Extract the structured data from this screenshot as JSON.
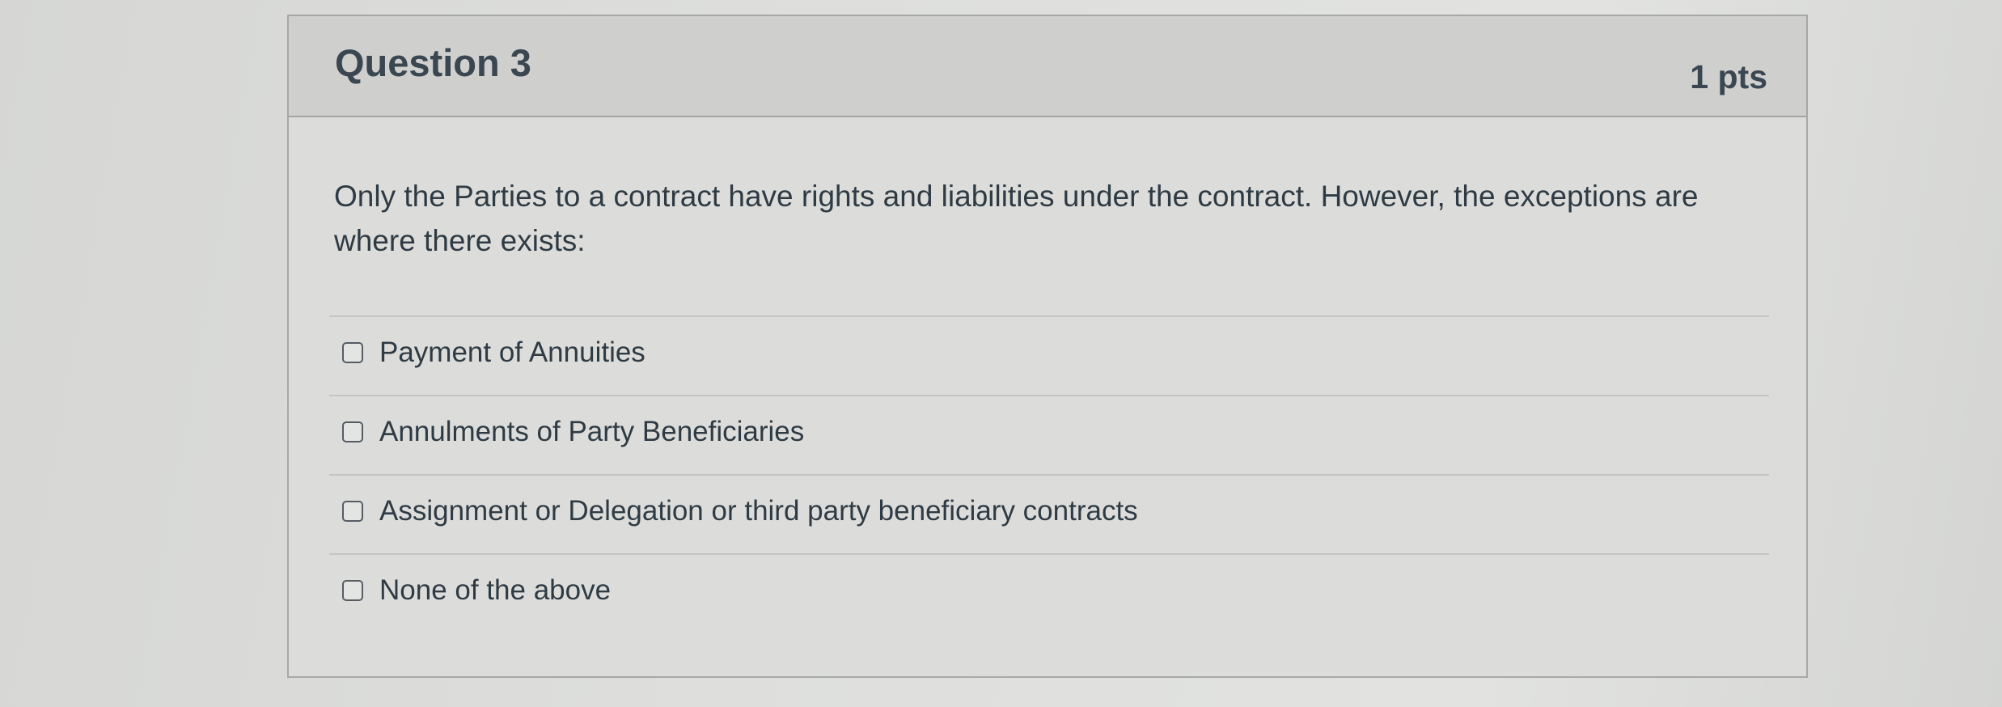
{
  "question": {
    "title": "Question 3",
    "points": "1 pts",
    "text": "Only the Parties to a contract have rights and liabilities under the contract. However, the exceptions are where there exists:",
    "answers": [
      {
        "label": "Payment of Annuities",
        "checked": false
      },
      {
        "label": "Annulments of Party Beneficiaries",
        "checked": false
      },
      {
        "label": "Assignment or Delegation or third party beneficiary contracts",
        "checked": false
      },
      {
        "label": "None of the above",
        "checked": false
      }
    ]
  }
}
